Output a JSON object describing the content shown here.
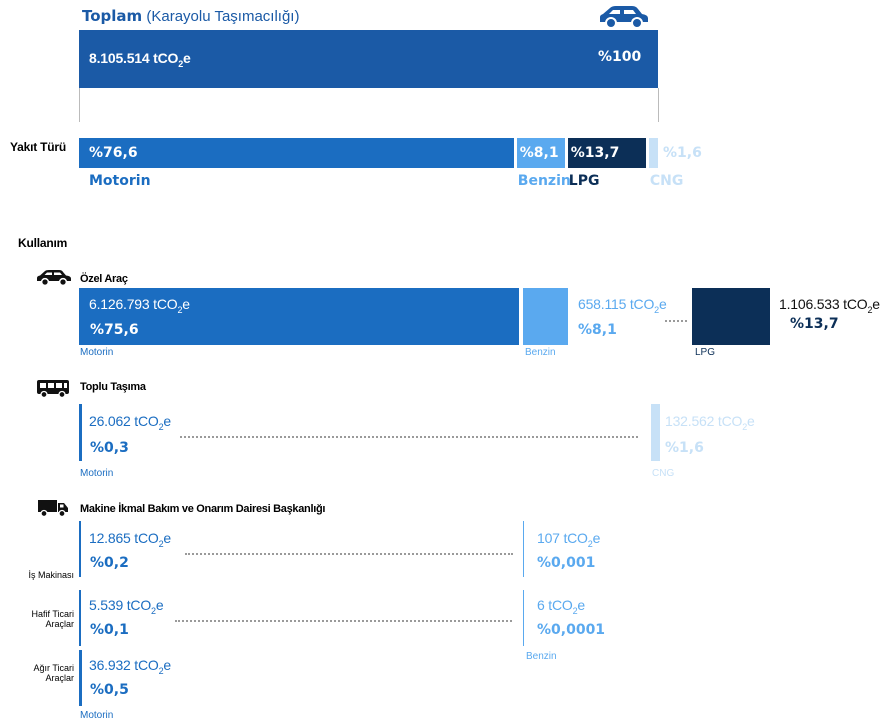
{
  "colors": {
    "toplam": "#1b5aa6",
    "motorin": "#1b6dc1",
    "benzin": "#5aa9ef",
    "lpg": "#0c2f57",
    "cng": "#c7e1f7"
  },
  "toplam": {
    "title_bold": "Toplam",
    "title_rest": "(Karayolu Taşımacılığı)",
    "value": "8.105.514 tCO",
    "value_sub": "2",
    "value_tail": "e",
    "pct": "%100",
    "icon": "car-icon"
  },
  "yakit": {
    "label": "Yakıt Türü",
    "segments": [
      {
        "pct": "%76,6",
        "name": "Motorin"
      },
      {
        "pct": "%8,1",
        "name": "Benzin"
      },
      {
        "pct": "%13,7",
        "name": "LPG"
      },
      {
        "pct": "%1,6",
        "name": "CNG"
      }
    ]
  },
  "kullanim": {
    "label": "Kullanım",
    "ozel": {
      "title": "Özel Araç",
      "icon": "car-icon",
      "motorin": {
        "value": "6.126.793 tCO",
        "pct": "%75,6",
        "name": "Motorin"
      },
      "benzin": {
        "value": "658.115 tCO",
        "pct": "%8,1",
        "name": "Benzin"
      },
      "lpg": {
        "value": "1.106.533 tCO",
        "pct": "%13,7",
        "name": "LPG"
      }
    },
    "toplu": {
      "title": "Toplu Taşıma",
      "icon": "bus-icon",
      "motorin": {
        "value": "26.062 tCO",
        "pct": "%0,3",
        "name": "Motorin"
      },
      "cng": {
        "value": "132.562 tCO",
        "pct": "%1,6",
        "name": "CNG"
      }
    },
    "makine": {
      "title": "Makine İkmal Bakım ve Onarım Dairesi Başkanlığı",
      "icon": "truck-icon",
      "rows": [
        {
          "label1": "İş Makinası",
          "label2": "",
          "motorin_value": "12.865 tCO",
          "motorin_pct": "%0,2",
          "benzin_value": "107 tCO",
          "benzin_pct": "%0,001"
        },
        {
          "label1": "Hafif Ticari",
          "label2": "Araçlar",
          "motorin_value": "5.539 tCO",
          "motorin_pct": "%0,1",
          "benzin_value": "6 tCO",
          "benzin_pct": "%0,0001"
        },
        {
          "label1": "Ağır Ticari",
          "label2": "Araçlar",
          "motorin_value": "36.932 tCO",
          "motorin_pct": "%0,5",
          "benzin_value": "",
          "benzin_pct": ""
        }
      ],
      "benzin_name": "Benzin",
      "motorin_name": "Motorin"
    }
  },
  "unit_sub": "2",
  "unit_tail": "e",
  "chart_data": {
    "type": "bar",
    "title": "Toplam (Karayolu Taşımacılığı)",
    "total": {
      "value_tco2e": 8105514,
      "pct": 100
    },
    "categories": [
      "Motorin",
      "Benzin",
      "LPG",
      "CNG"
    ],
    "values": [
      76.6,
      8.1,
      13.7,
      1.6
    ],
    "usage": [
      {
        "name": "Özel Araç",
        "series": [
          {
            "name": "Motorin",
            "tco2e": 6126793,
            "pct": 75.6
          },
          {
            "name": "Benzin",
            "tco2e": 658115,
            "pct": 8.1
          },
          {
            "name": "LPG",
            "tco2e": 1106533,
            "pct": 13.7
          }
        ]
      },
      {
        "name": "Toplu Taşıma",
        "series": [
          {
            "name": "Motorin",
            "tco2e": 26062,
            "pct": 0.3
          },
          {
            "name": "CNG",
            "tco2e": 132562,
            "pct": 1.6
          }
        ]
      },
      {
        "name": "İş Makinası",
        "series": [
          {
            "name": "Motorin",
            "tco2e": 12865,
            "pct": 0.2
          },
          {
            "name": "Benzin",
            "tco2e": 107,
            "pct": 0.001
          }
        ]
      },
      {
        "name": "Hafif Ticari Araçlar",
        "series": [
          {
            "name": "Motorin",
            "tco2e": 5539,
            "pct": 0.1
          },
          {
            "name": "Benzin",
            "tco2e": 6,
            "pct": 0.0001
          }
        ]
      },
      {
        "name": "Ağır Ticari Araçlar",
        "series": [
          {
            "name": "Motorin",
            "tco2e": 36932,
            "pct": 0.5
          }
        ]
      }
    ]
  }
}
